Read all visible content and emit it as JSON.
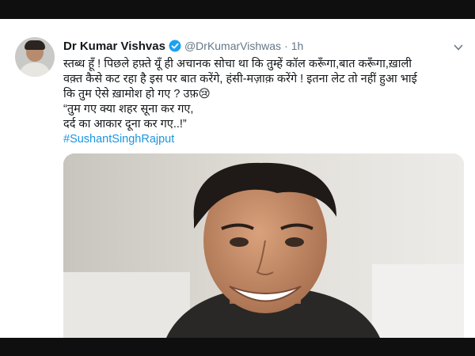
{
  "tweet": {
    "author_name": "Dr Kumar Vishvas",
    "handle": "@DrKumarVishwas",
    "separator": "·",
    "time": "1h",
    "text_line1": "स्तब्ध हूँ ! पिछले हफ़्ते यूँ ही अचानक सोचा था कि तुम्हें कॉल करूँगा,बात करूँगा,ख़ाली",
    "text_line2": "वक़्त कैसे कट रहा है इस पर बात करेंगे, हंसी-मज़ाक़ करेंगे ! इतना लेट तो नहीं हुआ भाई",
    "text_line3": "कि तुम ऐसे ख़ामोश हो गए ? उफ़😢",
    "quote_line1": "“तुम गए क्या शहर सूना कर गए,",
    "quote_line2": "दर्द का आकार दूना कर गए..!”",
    "hashtag": "#SushantSinghRajput"
  },
  "icons": {
    "verified": "verified-badge-icon",
    "more": "chevron-down-icon"
  },
  "colors": {
    "link": "#1b95e0",
    "muted": "#657786",
    "verified": "#1da1f2",
    "frame": "#0f0f0f"
  }
}
